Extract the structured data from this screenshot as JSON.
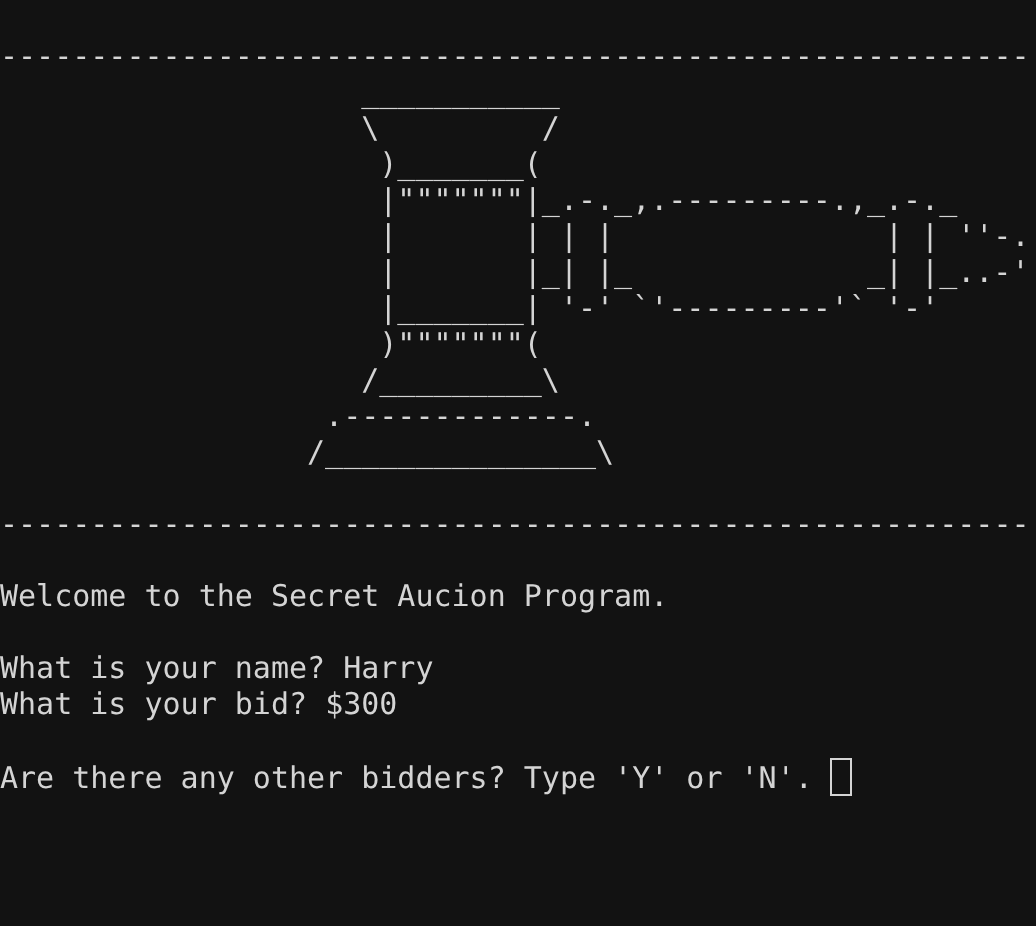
{
  "divider_top": "---------------------------------------------------------",
  "gavel_art": [
    "   ___________",
    "   \\         /",
    "    )_______(",
    "    |\"\"\"\"\"\"\"|_.-._,.---------.,_.-._",
    "    |       | | |               | | ''-.",
    "    |       |_| |_             _| |_..-'",
    "    |_______| '-' `'---------'` '-'",
    "    )\"\"\"\"\"\"\"(",
    "   /_________\\",
    " .-------------.",
    "/_______________\\"
  ],
  "divider_bottom": "---------------------------------------------------------",
  "welcome": "Welcome to the Secret Aucion Program.",
  "answers": [
    {
      "prompt": "What is your name?",
      "value": "Harry"
    },
    {
      "prompt": "What is your bid?",
      "value": "$300"
    }
  ],
  "question": "Are there any other bidders? Type 'Y' or 'N'."
}
